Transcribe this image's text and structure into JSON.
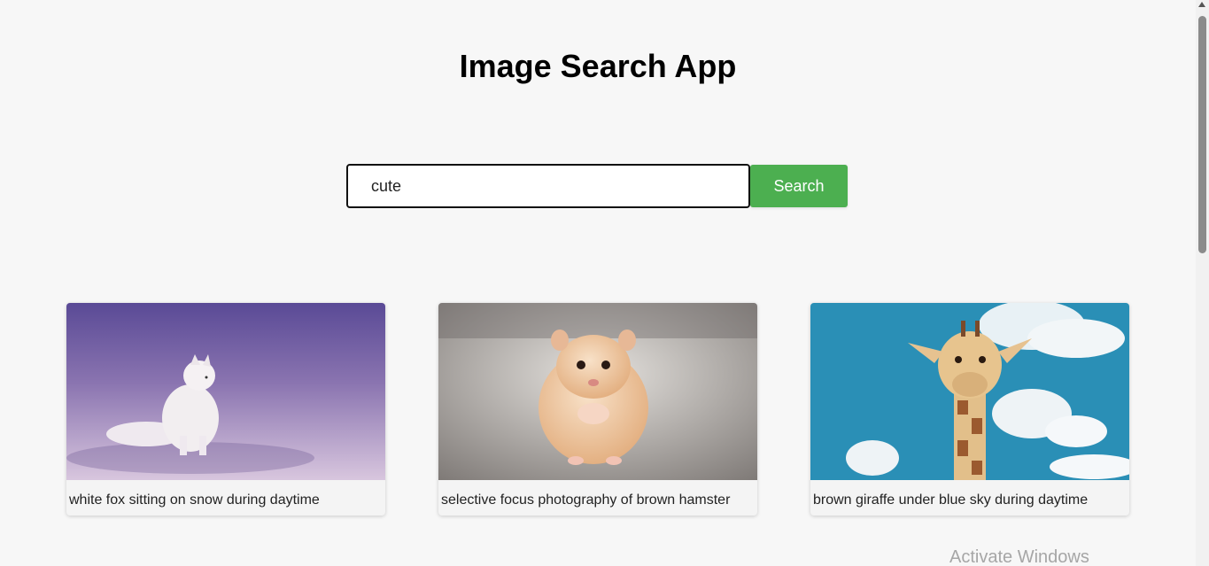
{
  "app": {
    "title": "Image Search App"
  },
  "search": {
    "value": "cute",
    "placeholder": "",
    "button_label": "Search"
  },
  "results": [
    {
      "caption": "white fox sitting on snow during daytime",
      "image": "arctic-fox-photo"
    },
    {
      "caption": "selective focus photography of brown hamster",
      "image": "hamster-photo"
    },
    {
      "caption": "brown giraffe under blue sky during daytime",
      "image": "giraffe-photo"
    }
  ],
  "os": {
    "watermark": "Activate Windows"
  },
  "colors": {
    "accent": "#4caf50",
    "background": "#f7f7f7"
  }
}
